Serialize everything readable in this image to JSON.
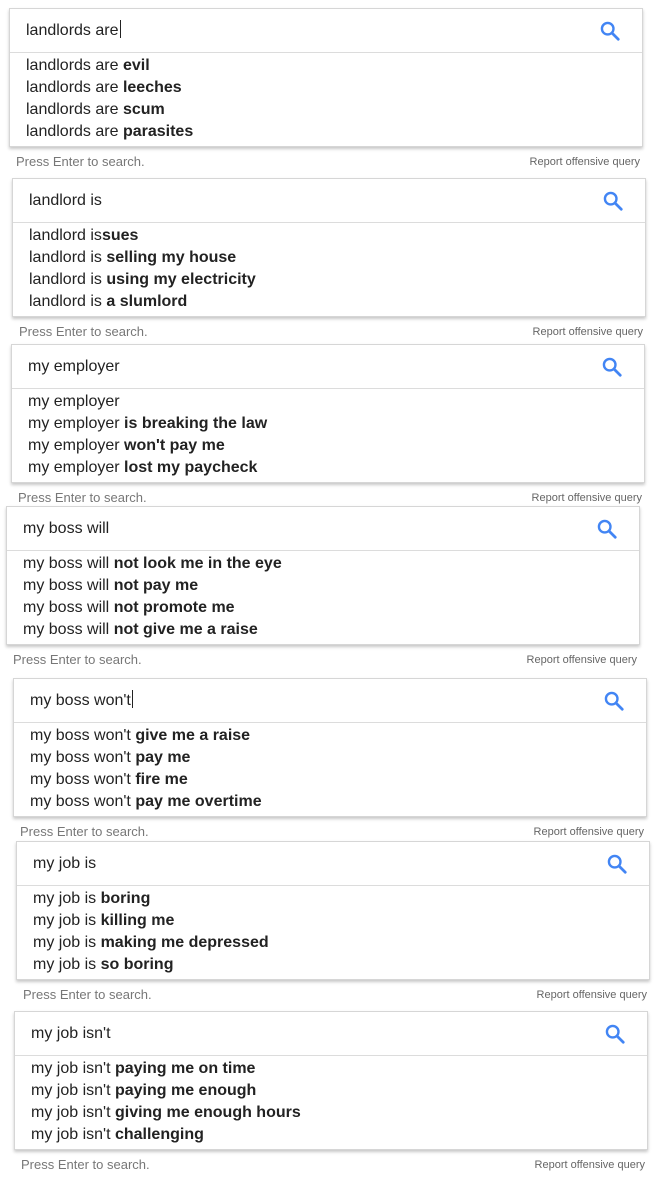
{
  "footer": {
    "press_enter": "Press Enter to search.",
    "report": "Report offensive query"
  },
  "panels": [
    {
      "query": "landlords are",
      "caret": true,
      "suggestions": [
        {
          "prefix": "landlords are ",
          "bold": "evil"
        },
        {
          "prefix": "landlords are ",
          "bold": "leeches"
        },
        {
          "prefix": "landlords are ",
          "bold": "scum"
        },
        {
          "prefix": "landlords are ",
          "bold": "parasites"
        }
      ]
    },
    {
      "query": "landlord is",
      "caret": false,
      "suggestions": [
        {
          "prefix": "landlord is",
          "bold": "sues"
        },
        {
          "prefix": "landlord is ",
          "bold": "selling my house"
        },
        {
          "prefix": "landlord is ",
          "bold": "using my electricity"
        },
        {
          "prefix": "landlord is ",
          "bold": "a slumlord"
        }
      ]
    },
    {
      "query": "my employer",
      "caret": false,
      "suggestions": [
        {
          "prefix": "my employer",
          "bold": ""
        },
        {
          "prefix": "my employer ",
          "bold": "is breaking the law"
        },
        {
          "prefix": "my employer ",
          "bold": "won't pay me"
        },
        {
          "prefix": "my employer ",
          "bold": "lost my paycheck"
        }
      ]
    },
    {
      "query": "my boss will",
      "caret": false,
      "suggestions": [
        {
          "prefix": "my boss will ",
          "bold": "not look me in the eye"
        },
        {
          "prefix": "my boss will ",
          "bold": "not pay me"
        },
        {
          "prefix": "my boss will ",
          "bold": "not promote me"
        },
        {
          "prefix": "my boss will ",
          "bold": "not give me a raise"
        }
      ]
    },
    {
      "query": "my boss won't",
      "caret": true,
      "suggestions": [
        {
          "prefix": "my boss won't ",
          "bold": "give me a raise"
        },
        {
          "prefix": "my boss won't ",
          "bold": "pay me"
        },
        {
          "prefix": "my boss won't ",
          "bold": "fire me"
        },
        {
          "prefix": "my boss won't ",
          "bold": "pay me overtime"
        }
      ]
    },
    {
      "query": "my job is",
      "caret": false,
      "suggestions": [
        {
          "prefix": "my job is ",
          "bold": "boring"
        },
        {
          "prefix": "my job is ",
          "bold": "killing me"
        },
        {
          "prefix": "my job is ",
          "bold": "making me depressed"
        },
        {
          "prefix": "my job is ",
          "bold": "so boring"
        }
      ]
    },
    {
      "query": "my job isn't",
      "caret": false,
      "suggestions": [
        {
          "prefix": "my job isn't ",
          "bold": "paying me on time"
        },
        {
          "prefix": "my job isn't ",
          "bold": "paying me enough"
        },
        {
          "prefix": "my job isn't ",
          "bold": "giving me enough hours"
        },
        {
          "prefix": "my job isn't ",
          "bold": "challenging"
        }
      ]
    }
  ]
}
